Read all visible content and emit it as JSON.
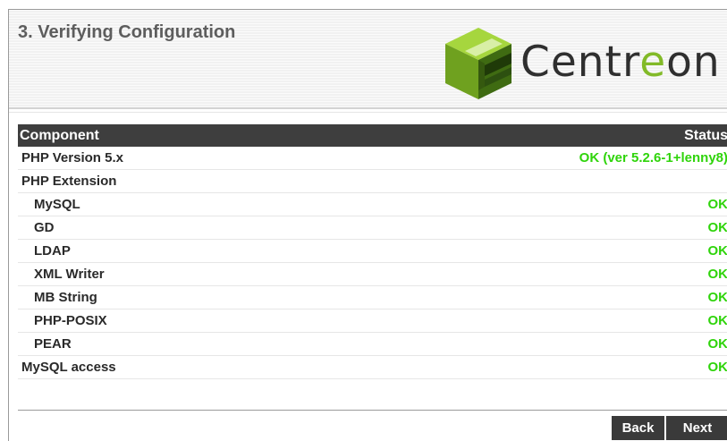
{
  "header": {
    "title": "3. Verifying Configuration",
    "logo_text_a": "Centr",
    "logo_text_b": "e",
    "logo_text_c": "on"
  },
  "table": {
    "col_component": "Component",
    "col_status": "Status",
    "rows": [
      {
        "name": "PHP Version 5.x",
        "status": "OK (ver 5.2.6-1+lenny8)"
      },
      {
        "name": "PHP Extension",
        "status": ""
      },
      {
        "name": "MySQL",
        "status": "OK"
      },
      {
        "name": "GD",
        "status": "OK"
      },
      {
        "name": "LDAP",
        "status": "OK"
      },
      {
        "name": "XML Writer",
        "status": "OK"
      },
      {
        "name": "MB String",
        "status": "OK"
      },
      {
        "name": "PHP-POSIX",
        "status": "OK"
      },
      {
        "name": "PEAR",
        "status": "OK"
      },
      {
        "name": "MySQL access",
        "status": "OK"
      }
    ]
  },
  "buttons": {
    "back": "Back",
    "next": "Next"
  },
  "colors": {
    "ok": "#2fd40b",
    "header_bar": "#3e3e3e",
    "logo_green": "#82ba28"
  }
}
